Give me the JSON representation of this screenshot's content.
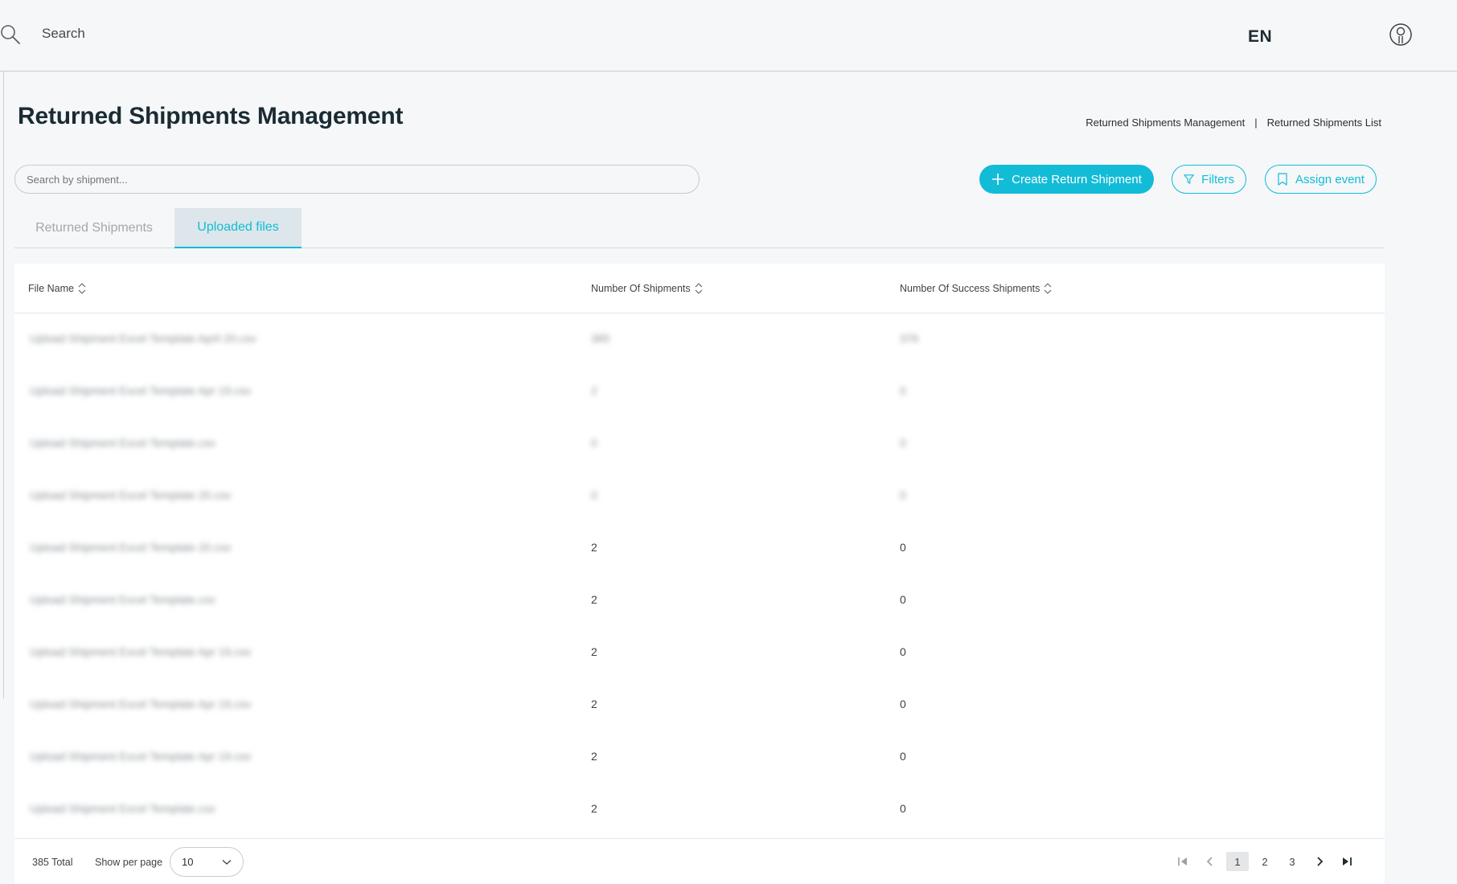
{
  "topbar": {
    "search_label": "Search",
    "language": "EN",
    "icons": {
      "search": "search-icon",
      "user": "user-circle-icon"
    }
  },
  "header": {
    "title": "Returned Shipments Management",
    "breadcrumb": [
      "Returned Shipments Management",
      "Returned Shipments List"
    ],
    "breadcrumb_separator": "|"
  },
  "toolbar": {
    "search_placeholder": "Search by shipment...",
    "create_label": "Create Return Shipment",
    "filters_label": "Filters",
    "assign_label": "Assign event"
  },
  "tabs": [
    {
      "label": "Returned Shipments",
      "active": false
    },
    {
      "label": "Uploaded files",
      "active": true
    }
  ],
  "table": {
    "columns": [
      "File Name",
      "Number Of Shipments",
      "Number Of Success Shipments"
    ],
    "rows": [
      {
        "file": "Upload Shipment Excel Template April 20.csv",
        "shipments": "385",
        "success": "376"
      },
      {
        "file": "Upload Shipment Excel Template Apr 19.csv",
        "shipments": "2",
        "success": "0"
      },
      {
        "file": "Upload Shipment Excel Template.csv",
        "shipments": "0",
        "success": "0"
      },
      {
        "file": "Upload Shipment Excel Template 20.csv",
        "shipments": "0",
        "success": "0"
      },
      {
        "file": "Upload Shipment Excel Template 20.csv",
        "shipments": "2",
        "success": "0"
      },
      {
        "file": "Upload Shipment Excel Template.csv",
        "shipments": "2",
        "success": "0"
      },
      {
        "file": "Upload Shipment Excel Template Apr 19.csv",
        "shipments": "2",
        "success": "0"
      },
      {
        "file": "Upload Shipment Excel Template Apr 19.csv",
        "shipments": "2",
        "success": "0"
      },
      {
        "file": "Upload Shipment Excel Template Apr 19.csv",
        "shipments": "2",
        "success": "0"
      },
      {
        "file": "Upload Shipment Excel Template.csv",
        "shipments": "2",
        "success": "0"
      }
    ]
  },
  "footer": {
    "total": "385 Total",
    "per_page_label": "Show per page",
    "per_page_value": "10",
    "pages": [
      "1",
      "2",
      "3"
    ],
    "current_page": "1"
  },
  "colors": {
    "accent": "#12bcd6",
    "background": "#f5f7f9"
  }
}
